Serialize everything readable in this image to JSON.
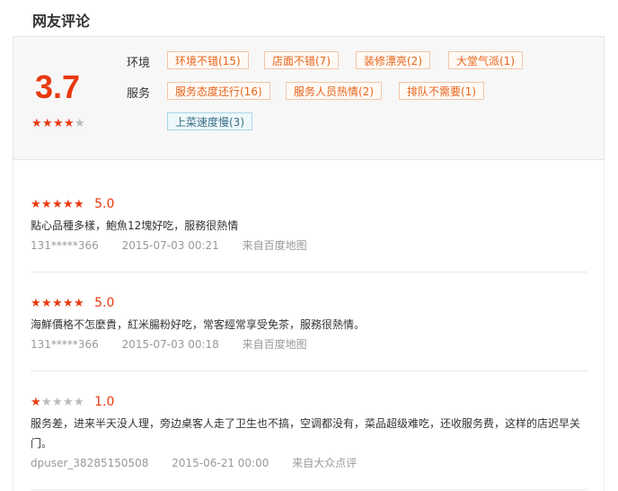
{
  "header": {
    "title": "网友评论"
  },
  "summary": {
    "score": "3.7",
    "stars": 4,
    "env_label": "环境",
    "service_label": "服务",
    "env_tags": [
      "环境不错(15)",
      "店面不错(7)",
      "装修漂亮(2)",
      "大堂气派(1)"
    ],
    "service_tags": [
      "服务态度还行(16)",
      "服务人员热情(2)",
      "排队不需要(1)"
    ],
    "negative_tags": [
      "上菜速度慢(3)"
    ]
  },
  "reviews": [
    {
      "stars": 5,
      "score": "5.0",
      "text": "點心品種多樣，鮑魚12塊好吃，服務很熱情",
      "user": "131*****366",
      "time": "2015-07-03 00:21",
      "source": "来自百度地图"
    },
    {
      "stars": 5,
      "score": "5.0",
      "text": "海鮮價格不怎麼貴，紅米腸粉好吃，常客經常享受免茶，服務很熱情。",
      "user": "131*****366",
      "time": "2015-07-03 00:18",
      "source": "来自百度地图"
    },
    {
      "stars": 1,
      "score": "1.0",
      "text": "服务差，进来半天没人理，旁边桌客人走了卫生也不搞，空调都没有，菜品超级难吃，还收服务费，这样的店迟早关门。",
      "user": "dpuser_38285150508",
      "time": "2015-06-21 00:00",
      "source": "来自大众点评"
    }
  ],
  "colors": {
    "accent": "#e8390e",
    "tag_text": "#e8641b",
    "neg_tag_text": "#3a6f86"
  },
  "icons": {
    "star": "star-icon"
  }
}
